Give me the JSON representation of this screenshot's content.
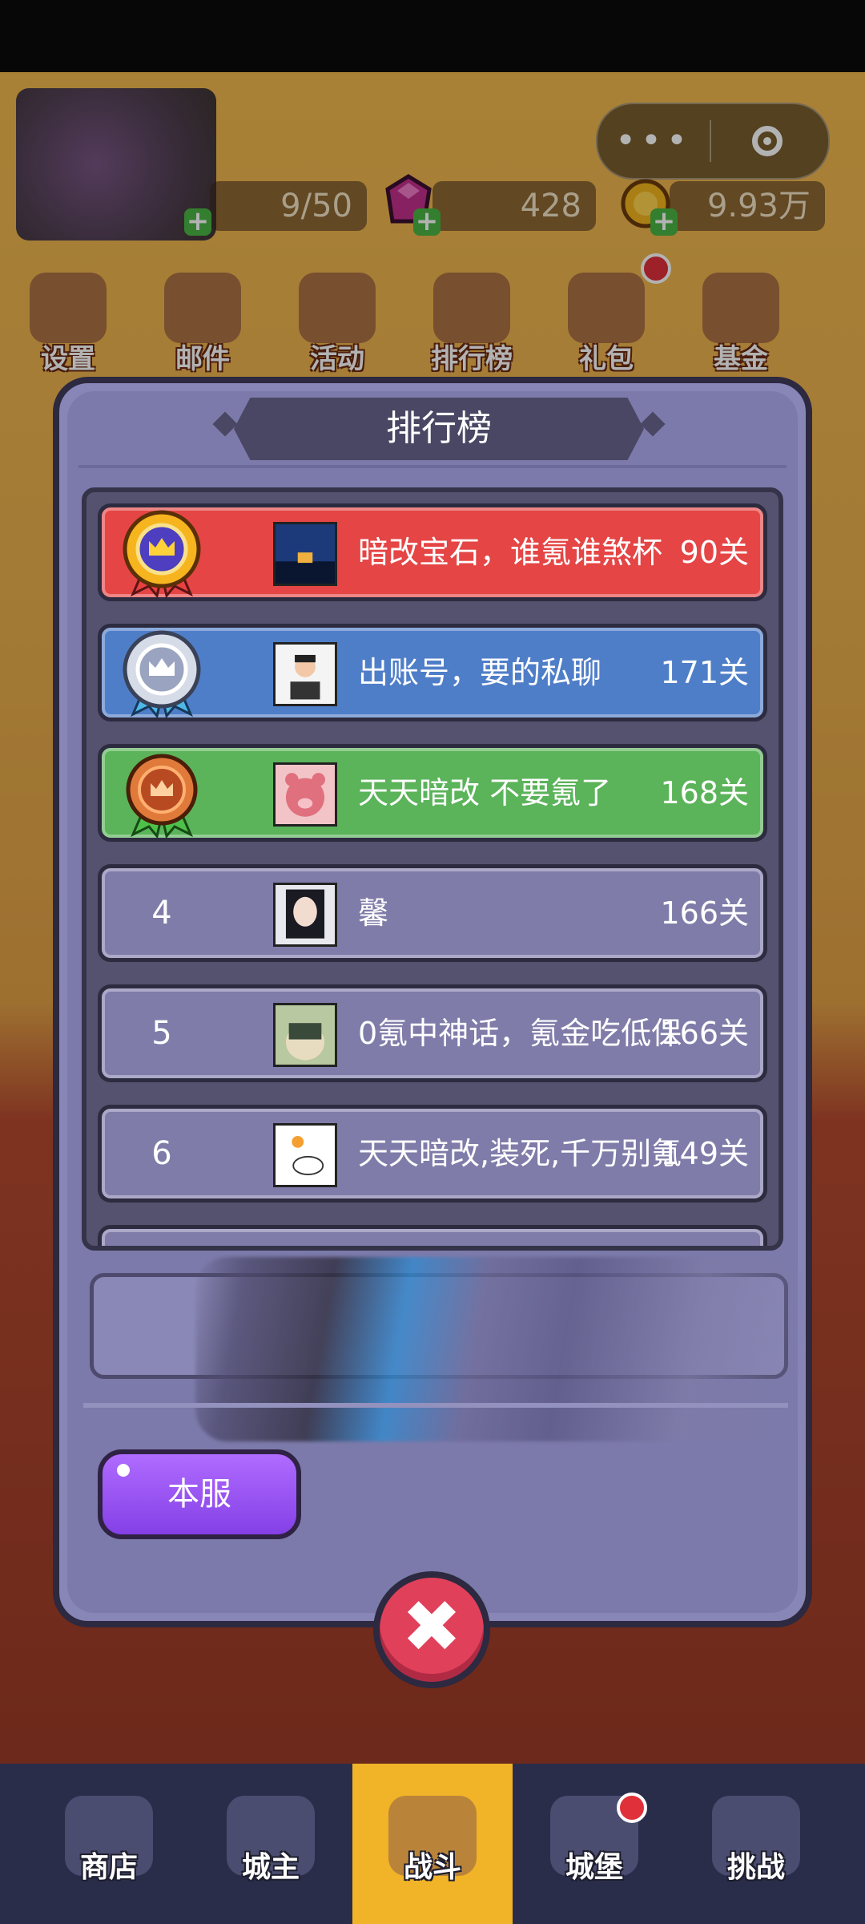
{
  "wechat_capsule": {
    "more": "•••"
  },
  "resources": {
    "stamina": "9/50",
    "gems": "428",
    "gold": "9.93万"
  },
  "top_nav": [
    {
      "label": "设置"
    },
    {
      "label": "邮件"
    },
    {
      "label": "活动"
    },
    {
      "label": "排行榜"
    },
    {
      "label": "礼包"
    },
    {
      "label": "基金"
    }
  ],
  "dialog": {
    "title": "排行榜",
    "rows": [
      {
        "rank": "1",
        "name": "暗改宝石，谁氪谁煞杯",
        "score": "90关"
      },
      {
        "rank": "2",
        "name": "出账号，要的私聊",
        "score": "171关"
      },
      {
        "rank": "3",
        "name": "天天暗改 不要氪了",
        "score": "168关"
      },
      {
        "rank": "4",
        "name": "馨",
        "score": "166关"
      },
      {
        "rank": "5",
        "name": "0氪中神话，氪金吃低保",
        "score": "166关"
      },
      {
        "rank": "6",
        "name": "天天暗改,装死,千万别氪",
        "score": "149关"
      }
    ],
    "server_button": "本服",
    "close_label": "✖"
  },
  "tabs": [
    {
      "label": "商店"
    },
    {
      "label": "城主"
    },
    {
      "label": "战斗"
    },
    {
      "label": "城堡"
    },
    {
      "label": "挑战"
    }
  ],
  "colors": {
    "rank1": "#e54545",
    "rank2": "#4f7ec8",
    "rank3": "#5bb35a",
    "rank_other": "#7f7ca9",
    "dialog": "#8886b7",
    "active_tab": "#f1b327"
  }
}
